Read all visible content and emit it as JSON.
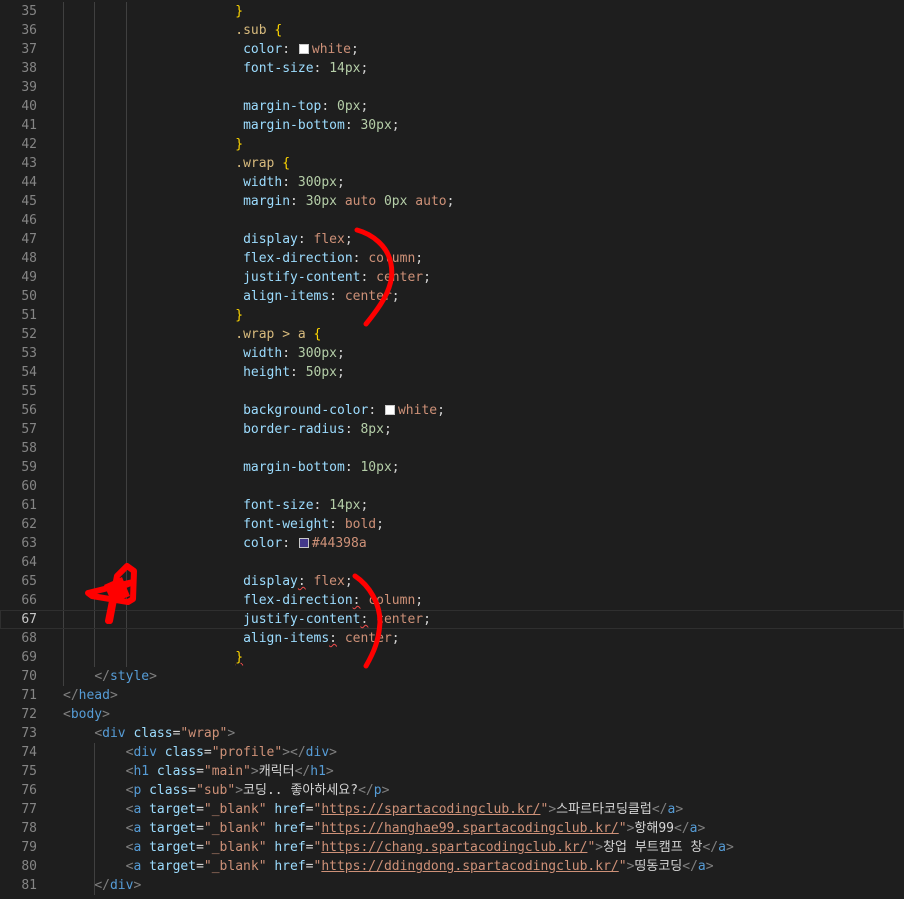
{
  "editor": {
    "first_line_number": 35,
    "current_line_number": 67,
    "lines": [
      {
        "indent": 22,
        "tokens": [
          {
            "c": "t-brace",
            "t": "}"
          }
        ]
      },
      {
        "indent": 22,
        "tokens": [
          {
            "c": "t-sel",
            "t": ".sub"
          },
          {
            "c": "t-punc",
            "t": " "
          },
          {
            "c": "t-brace",
            "t": "{"
          }
        ]
      },
      {
        "indent": 23,
        "tokens": [
          {
            "c": "t-prop",
            "t": "color"
          },
          {
            "c": "t-punc",
            "t": ": "
          },
          {
            "swatch": "#ffffff"
          },
          {
            "c": "t-val",
            "t": "white"
          },
          {
            "c": "t-punc",
            "t": ";"
          }
        ]
      },
      {
        "indent": 23,
        "tokens": [
          {
            "c": "t-prop",
            "t": "font-size"
          },
          {
            "c": "t-punc",
            "t": ": "
          },
          {
            "c": "t-num",
            "t": "14px"
          },
          {
            "c": "t-punc",
            "t": ";"
          }
        ]
      },
      {
        "indent": 0,
        "tokens": []
      },
      {
        "indent": 23,
        "tokens": [
          {
            "c": "t-prop",
            "t": "margin-top"
          },
          {
            "c": "t-punc",
            "t": ": "
          },
          {
            "c": "t-num",
            "t": "0px"
          },
          {
            "c": "t-punc",
            "t": ";"
          }
        ]
      },
      {
        "indent": 23,
        "tokens": [
          {
            "c": "t-prop",
            "t": "margin-bottom"
          },
          {
            "c": "t-punc",
            "t": ": "
          },
          {
            "c": "t-num",
            "t": "30px"
          },
          {
            "c": "t-punc",
            "t": ";"
          }
        ]
      },
      {
        "indent": 22,
        "tokens": [
          {
            "c": "t-brace",
            "t": "}"
          }
        ]
      },
      {
        "indent": 22,
        "tokens": [
          {
            "c": "t-sel",
            "t": ".wrap"
          },
          {
            "c": "t-punc",
            "t": " "
          },
          {
            "c": "t-brace",
            "t": "{"
          }
        ]
      },
      {
        "indent": 23,
        "tokens": [
          {
            "c": "t-prop",
            "t": "width"
          },
          {
            "c": "t-punc",
            "t": ": "
          },
          {
            "c": "t-num",
            "t": "300px"
          },
          {
            "c": "t-punc",
            "t": ";"
          }
        ]
      },
      {
        "indent": 23,
        "tokens": [
          {
            "c": "t-prop",
            "t": "margin"
          },
          {
            "c": "t-punc",
            "t": ": "
          },
          {
            "c": "t-num",
            "t": "30px"
          },
          {
            "c": "t-val",
            "t": " auto "
          },
          {
            "c": "t-num",
            "t": "0px"
          },
          {
            "c": "t-val",
            "t": " auto"
          },
          {
            "c": "t-punc",
            "t": ";"
          }
        ]
      },
      {
        "indent": 0,
        "tokens": []
      },
      {
        "indent": 23,
        "tokens": [
          {
            "c": "t-prop",
            "t": "display"
          },
          {
            "c": "t-punc",
            "t": ": "
          },
          {
            "c": "t-val",
            "t": "flex"
          },
          {
            "c": "t-punc",
            "t": ";"
          }
        ]
      },
      {
        "indent": 23,
        "tokens": [
          {
            "c": "t-prop",
            "t": "flex-direction"
          },
          {
            "c": "t-punc",
            "t": ": "
          },
          {
            "c": "t-val",
            "t": "column"
          },
          {
            "c": "t-punc",
            "t": ";"
          }
        ]
      },
      {
        "indent": 23,
        "tokens": [
          {
            "c": "t-prop",
            "t": "justify-content"
          },
          {
            "c": "t-punc",
            "t": ": "
          },
          {
            "c": "t-val",
            "t": "center"
          },
          {
            "c": "t-punc",
            "t": ";"
          }
        ]
      },
      {
        "indent": 23,
        "tokens": [
          {
            "c": "t-prop",
            "t": "align-items"
          },
          {
            "c": "t-punc",
            "t": ": "
          },
          {
            "c": "t-val",
            "t": "center"
          },
          {
            "c": "t-punc",
            "t": ";"
          }
        ]
      },
      {
        "indent": 22,
        "tokens": [
          {
            "c": "t-brace",
            "t": "}"
          }
        ]
      },
      {
        "indent": 22,
        "tokens": [
          {
            "c": "t-sel",
            "t": ".wrap > a"
          },
          {
            "c": "t-punc",
            "t": " "
          },
          {
            "c": "t-brace",
            "t": "{"
          }
        ]
      },
      {
        "indent": 23,
        "tokens": [
          {
            "c": "t-prop",
            "t": "width"
          },
          {
            "c": "t-punc",
            "t": ": "
          },
          {
            "c": "t-num",
            "t": "300px"
          },
          {
            "c": "t-punc",
            "t": ";"
          }
        ]
      },
      {
        "indent": 23,
        "tokens": [
          {
            "c": "t-prop",
            "t": "height"
          },
          {
            "c": "t-punc",
            "t": ": "
          },
          {
            "c": "t-num",
            "t": "50px"
          },
          {
            "c": "t-punc",
            "t": ";"
          }
        ]
      },
      {
        "indent": 0,
        "tokens": []
      },
      {
        "indent": 23,
        "tokens": [
          {
            "c": "t-prop",
            "t": "background-color"
          },
          {
            "c": "t-punc",
            "t": ": "
          },
          {
            "swatch": "#ffffff"
          },
          {
            "c": "t-val",
            "t": "white"
          },
          {
            "c": "t-punc",
            "t": ";"
          }
        ]
      },
      {
        "indent": 23,
        "tokens": [
          {
            "c": "t-prop",
            "t": "border-radius"
          },
          {
            "c": "t-punc",
            "t": ": "
          },
          {
            "c": "t-num",
            "t": "8px"
          },
          {
            "c": "t-punc",
            "t": ";"
          }
        ]
      },
      {
        "indent": 0,
        "tokens": []
      },
      {
        "indent": 23,
        "tokens": [
          {
            "c": "t-prop",
            "t": "margin-bottom"
          },
          {
            "c": "t-punc",
            "t": ": "
          },
          {
            "c": "t-num",
            "t": "10px"
          },
          {
            "c": "t-punc",
            "t": ";"
          }
        ]
      },
      {
        "indent": 0,
        "tokens": []
      },
      {
        "indent": 23,
        "tokens": [
          {
            "c": "t-prop",
            "t": "font-size"
          },
          {
            "c": "t-punc",
            "t": ": "
          },
          {
            "c": "t-num",
            "t": "14px"
          },
          {
            "c": "t-punc",
            "t": ";"
          }
        ]
      },
      {
        "indent": 23,
        "tokens": [
          {
            "c": "t-prop",
            "t": "font-weight"
          },
          {
            "c": "t-punc",
            "t": ": "
          },
          {
            "c": "t-val",
            "t": "bold"
          },
          {
            "c": "t-punc",
            "t": ";"
          }
        ]
      },
      {
        "indent": 23,
        "tokens": [
          {
            "c": "t-prop",
            "t": "color"
          },
          {
            "c": "t-punc",
            "t": ": "
          },
          {
            "swatch": "#44398a"
          },
          {
            "c": "t-val",
            "t": "#44398a"
          }
        ]
      },
      {
        "indent": 0,
        "tokens": []
      },
      {
        "indent": 23,
        "tokens": [
          {
            "c": "t-prop",
            "t": "display"
          },
          {
            "c": "t-punc squig",
            "t": ":"
          },
          {
            "c": "t-punc",
            "t": " "
          },
          {
            "c": "t-val",
            "t": "flex"
          },
          {
            "c": "t-punc",
            "t": ";"
          }
        ]
      },
      {
        "indent": 23,
        "tokens": [
          {
            "c": "t-prop",
            "t": "flex-direction"
          },
          {
            "c": "t-punc squig",
            "t": ":"
          },
          {
            "c": "t-punc",
            "t": " "
          },
          {
            "c": "t-val",
            "t": "column"
          },
          {
            "c": "t-punc",
            "t": ";"
          }
        ]
      },
      {
        "indent": 23,
        "tokens": [
          {
            "c": "t-prop",
            "t": "justify-content"
          },
          {
            "c": "t-punc squig",
            "t": ":"
          },
          {
            "c": "t-punc",
            "t": " "
          },
          {
            "c": "t-val",
            "t": "center"
          },
          {
            "c": "t-punc",
            "t": ";"
          }
        ]
      },
      {
        "indent": 23,
        "tokens": [
          {
            "c": "t-prop",
            "t": "align-items"
          },
          {
            "c": "t-punc squig",
            "t": ":"
          },
          {
            "c": "t-punc",
            "t": " "
          },
          {
            "c": "t-val",
            "t": "center"
          },
          {
            "c": "t-punc",
            "t": ";"
          }
        ]
      },
      {
        "indent": 22,
        "tokens": [
          {
            "c": "t-brace squig",
            "t": "}"
          }
        ]
      },
      {
        "indent": 4,
        "tokens": [
          {
            "c": "t-bracket",
            "t": "</"
          },
          {
            "c": "t-tag",
            "t": "style"
          },
          {
            "c": "t-bracket",
            "t": ">"
          }
        ]
      },
      {
        "indent": 0,
        "tokens": [
          {
            "c": "t-bracket",
            "t": "</"
          },
          {
            "c": "t-tag",
            "t": "head"
          },
          {
            "c": "t-bracket",
            "t": ">"
          }
        ]
      },
      {
        "indent": 0,
        "tokens": [
          {
            "c": "t-bracket",
            "t": "<"
          },
          {
            "c": "t-tag",
            "t": "body"
          },
          {
            "c": "t-bracket",
            "t": ">"
          }
        ]
      },
      {
        "indent": 4,
        "tokens": [
          {
            "c": "t-bracket",
            "t": "<"
          },
          {
            "c": "t-tag",
            "t": "div"
          },
          {
            "c": "t-attr",
            "t": " class"
          },
          {
            "c": "t-punc",
            "t": "="
          },
          {
            "c": "t-str",
            "t": "\"wrap\""
          },
          {
            "c": "t-bracket",
            "t": ">"
          }
        ]
      },
      {
        "indent": 8,
        "tokens": [
          {
            "c": "t-bracket",
            "t": "<"
          },
          {
            "c": "t-tag",
            "t": "div"
          },
          {
            "c": "t-attr",
            "t": " class"
          },
          {
            "c": "t-punc",
            "t": "="
          },
          {
            "c": "t-str",
            "t": "\"profile\""
          },
          {
            "c": "t-bracket",
            "t": "></"
          },
          {
            "c": "t-tag",
            "t": "div"
          },
          {
            "c": "t-bracket",
            "t": ">"
          }
        ]
      },
      {
        "indent": 8,
        "tokens": [
          {
            "c": "t-bracket",
            "t": "<"
          },
          {
            "c": "t-tag",
            "t": "h1"
          },
          {
            "c": "t-attr",
            "t": " class"
          },
          {
            "c": "t-punc",
            "t": "="
          },
          {
            "c": "t-str",
            "t": "\"main\""
          },
          {
            "c": "t-bracket",
            "t": ">"
          },
          {
            "c": "t-text",
            "t": "캐릭터"
          },
          {
            "c": "t-bracket",
            "t": "</"
          },
          {
            "c": "t-tag",
            "t": "h1"
          },
          {
            "c": "t-bracket",
            "t": ">"
          }
        ]
      },
      {
        "indent": 8,
        "tokens": [
          {
            "c": "t-bracket",
            "t": "<"
          },
          {
            "c": "t-tag",
            "t": "p"
          },
          {
            "c": "t-attr",
            "t": " class"
          },
          {
            "c": "t-punc",
            "t": "="
          },
          {
            "c": "t-str",
            "t": "\"sub\""
          },
          {
            "c": "t-bracket",
            "t": ">"
          },
          {
            "c": "t-text",
            "t": "코딩.. 좋아하세요?"
          },
          {
            "c": "t-bracket",
            "t": "</"
          },
          {
            "c": "t-tag",
            "t": "p"
          },
          {
            "c": "t-bracket",
            "t": ">"
          }
        ]
      },
      {
        "indent": 8,
        "tokens": [
          {
            "c": "t-bracket",
            "t": "<"
          },
          {
            "c": "t-tag",
            "t": "a"
          },
          {
            "c": "t-attr",
            "t": " target"
          },
          {
            "c": "t-punc",
            "t": "="
          },
          {
            "c": "t-str",
            "t": "\"_blank\""
          },
          {
            "c": "t-attr",
            "t": " href"
          },
          {
            "c": "t-punc",
            "t": "="
          },
          {
            "c": "t-str",
            "t": "\""
          },
          {
            "c": "t-url",
            "t": "https://spartacodingclub.kr/"
          },
          {
            "c": "t-str",
            "t": "\""
          },
          {
            "c": "t-bracket",
            "t": ">"
          },
          {
            "c": "t-text",
            "t": "스파르타코딩클럽"
          },
          {
            "c": "t-bracket",
            "t": "</"
          },
          {
            "c": "t-tag",
            "t": "a"
          },
          {
            "c": "t-bracket",
            "t": ">"
          }
        ]
      },
      {
        "indent": 8,
        "tokens": [
          {
            "c": "t-bracket",
            "t": "<"
          },
          {
            "c": "t-tag",
            "t": "a"
          },
          {
            "c": "t-attr",
            "t": " target"
          },
          {
            "c": "t-punc",
            "t": "="
          },
          {
            "c": "t-str",
            "t": "\"_blank\""
          },
          {
            "c": "t-attr",
            "t": " href"
          },
          {
            "c": "t-punc",
            "t": "="
          },
          {
            "c": "t-str",
            "t": "\""
          },
          {
            "c": "t-url",
            "t": "https://hanghae99.spartacodingclub.kr/"
          },
          {
            "c": "t-str",
            "t": "\""
          },
          {
            "c": "t-bracket",
            "t": ">"
          },
          {
            "c": "t-text",
            "t": "항해99"
          },
          {
            "c": "t-bracket",
            "t": "</"
          },
          {
            "c": "t-tag",
            "t": "a"
          },
          {
            "c": "t-bracket",
            "t": ">"
          }
        ]
      },
      {
        "indent": 8,
        "tokens": [
          {
            "c": "t-bracket",
            "t": "<"
          },
          {
            "c": "t-tag",
            "t": "a"
          },
          {
            "c": "t-attr",
            "t": " target"
          },
          {
            "c": "t-punc",
            "t": "="
          },
          {
            "c": "t-str",
            "t": "\"_blank\""
          },
          {
            "c": "t-attr",
            "t": " href"
          },
          {
            "c": "t-punc",
            "t": "="
          },
          {
            "c": "t-str",
            "t": "\""
          },
          {
            "c": "t-url",
            "t": "https://chang.spartacodingclub.kr/"
          },
          {
            "c": "t-str",
            "t": "\""
          },
          {
            "c": "t-bracket",
            "t": ">"
          },
          {
            "c": "t-text",
            "t": "창업 부트캠프 창"
          },
          {
            "c": "t-bracket",
            "t": "</"
          },
          {
            "c": "t-tag",
            "t": "a"
          },
          {
            "c": "t-bracket",
            "t": ">"
          }
        ]
      },
      {
        "indent": 8,
        "tokens": [
          {
            "c": "t-bracket",
            "t": "<"
          },
          {
            "c": "t-tag",
            "t": "a"
          },
          {
            "c": "t-attr",
            "t": " target"
          },
          {
            "c": "t-punc",
            "t": "="
          },
          {
            "c": "t-str",
            "t": "\"_blank\""
          },
          {
            "c": "t-attr",
            "t": " href"
          },
          {
            "c": "t-punc",
            "t": "="
          },
          {
            "c": "t-str",
            "t": "\""
          },
          {
            "c": "t-url",
            "t": "https://ddingdong.spartacodingclub.kr/"
          },
          {
            "c": "t-str",
            "t": "\""
          },
          {
            "c": "t-bracket",
            "t": ">"
          },
          {
            "c": "t-text",
            "t": "띵동코딩"
          },
          {
            "c": "t-bracket",
            "t": "</"
          },
          {
            "c": "t-tag",
            "t": "a"
          },
          {
            "c": "t-bracket",
            "t": ">"
          }
        ]
      },
      {
        "indent": 4,
        "tokens": [
          {
            "c": "t-bracket",
            "t": "</"
          },
          {
            "c": "t-tag",
            "t": "div"
          },
          {
            "c": "t-bracket",
            "t": ">"
          }
        ]
      }
    ]
  },
  "annotations": {
    "ink_color": "#ff0000",
    "marks": [
      "bracket-mark-upper",
      "bracket-mark-lower",
      "star-mark"
    ]
  }
}
